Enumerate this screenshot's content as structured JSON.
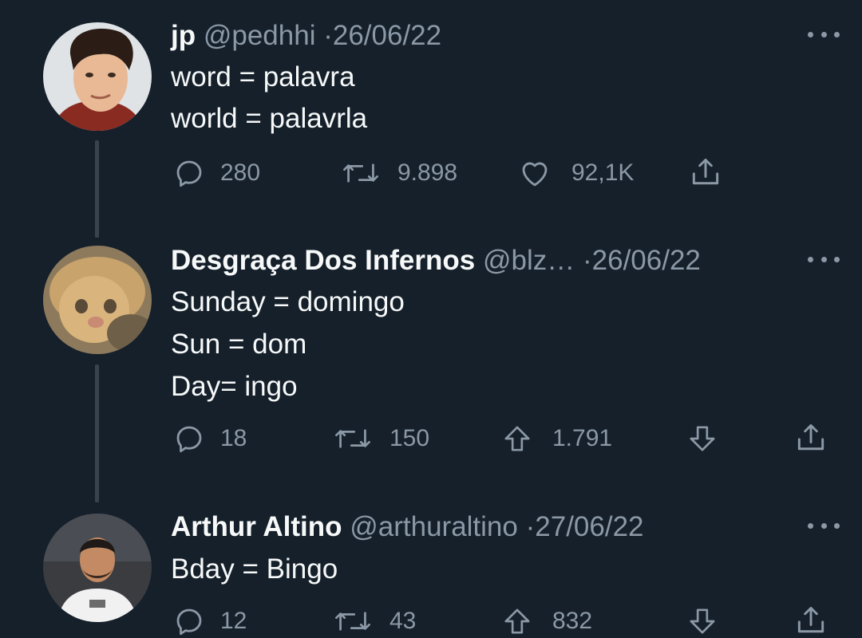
{
  "tweets": [
    {
      "name": "jp",
      "handle": "@pedhhi",
      "separator": "·",
      "date": "26/06/22",
      "lines": [
        "word = palavra",
        "world = palavrla"
      ],
      "actions": {
        "replies": "280",
        "retweets": "9.898",
        "likes": "92,1K"
      }
    },
    {
      "name": "Desgraça Dos Infernos",
      "handle": "@blz…",
      "separator": "·",
      "date": "26/06/22",
      "lines": [
        "Sunday = domingo",
        "Sun = dom",
        "Day= ingo"
      ],
      "actions": {
        "replies": "18",
        "retweets": "150",
        "upvotes": "1.791"
      }
    },
    {
      "name": "Arthur Altino",
      "handle": "@arthuraltino",
      "separator": "·",
      "date": "27/06/22",
      "lines": [
        "Bday = Bingo"
      ],
      "actions": {
        "replies": "12",
        "retweets": "43",
        "upvotes": "832"
      }
    }
  ],
  "icons": {
    "reply": "reply-icon",
    "retweet": "retweet-icon",
    "like": "heart-icon",
    "upvote": "arrow-up-icon",
    "downvote": "arrow-down-icon",
    "share": "share-icon",
    "more": "more-icon"
  },
  "colors": {
    "background": "#15202b",
    "text": "#f7f9f9",
    "muted": "#8b98a5",
    "thread_line": "#38444d"
  }
}
